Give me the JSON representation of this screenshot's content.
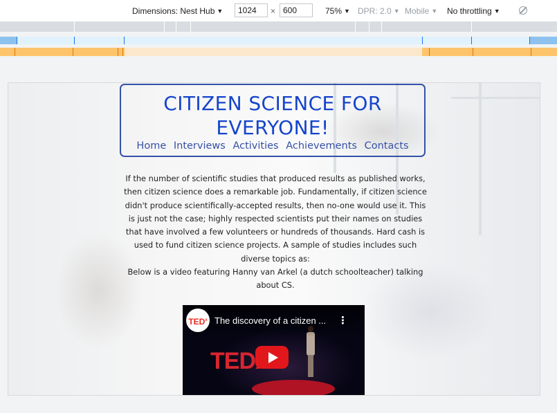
{
  "devtools": {
    "dimensions_label": "Dimensions: Nest Hub",
    "width_value": "1024",
    "times": "×",
    "height_value": "600",
    "zoom": "75%",
    "dpr": "DPR: 2.0",
    "mobile": "Mobile",
    "throttling": "No throttling",
    "caret": "▼"
  },
  "site": {
    "title": "CITIZEN SCIENCE FOR EVERYONE!",
    "nav": [
      "Home",
      "Interviews",
      "Activities",
      "Achievements",
      "Contacts"
    ],
    "paragraphs": [
      "If the number of scientific studies that produced results as published works, then citizen science does a remarkable job. Fundamentally, if citizen science didn't produce scientifically-accepted results, then no-one would use it. This is just not the case; highly respected scientists put their names on studies that have involved a few volunteers or hundreds of thousands. Hard cash is used to fund citizen science projects. A sample of studies includes such diverse topics as:",
      "Below is a video featuring Hanny van Arkel (a dutch schoolteacher) talking about CS."
    ]
  },
  "video": {
    "channel_logo_text": "TED",
    "channel_logo_sup": "x",
    "title": "The discovery of a citizen ...",
    "background_text": "TEDx",
    "menu_glyph": "⋮"
  },
  "colors": {
    "title_blue": "#1544cc",
    "nav_blue": "#3551a8",
    "ted_red": "#e62b1e",
    "yt_red": "#e2171c"
  },
  "icons": [
    "dropdown-caret-icon",
    "rotate-icon",
    "play-icon",
    "more-vert-icon"
  ]
}
